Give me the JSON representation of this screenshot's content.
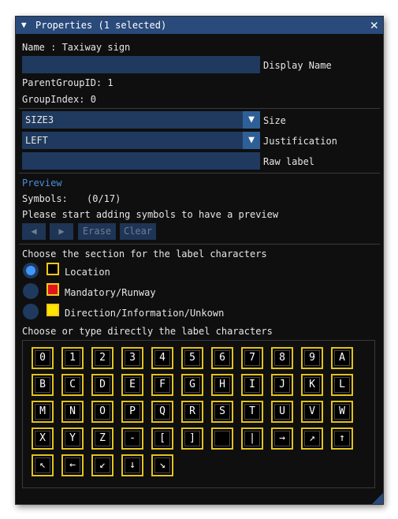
{
  "window": {
    "title": "Properties (1 selected)",
    "collapse_glyph": "▼",
    "close_glyph": "✕"
  },
  "info": {
    "name_line": "Name : Taxiway sign",
    "display_name_value": "",
    "display_name_label": "Display Name",
    "parent_group_line": "ParentGroupID: 1",
    "group_index_line": "GroupIndex: 0"
  },
  "controls": {
    "size_value": "SIZE3",
    "size_label": "Size",
    "justification_value": "LEFT",
    "justification_label": "Justification",
    "raw_label_value": "",
    "raw_label_label": "Raw label",
    "dropdown_glyph": "▼"
  },
  "preview": {
    "header": "Preview",
    "symbols_label": "Symbols:",
    "symbols_count": "(0/17)",
    "message": "Please start adding symbols to have a preview",
    "prev_glyph": "◀",
    "next_glyph": "▶",
    "erase_label": "Erase",
    "clear_label": "Clear"
  },
  "sections": {
    "prompt": "Choose the section for the label characters",
    "options": [
      {
        "label": "Location",
        "selected": true,
        "swatch": "#000000"
      },
      {
        "label": "Mandatory/Runway",
        "selected": false,
        "swatch": "#e0141c"
      },
      {
        "label": "Direction/Information/Unkown",
        "selected": false,
        "swatch": "#ffe600"
      }
    ]
  },
  "characters": {
    "prompt": "Choose or type directly the label characters",
    "keys": [
      "0",
      "1",
      "2",
      "3",
      "4",
      "5",
      "6",
      "7",
      "8",
      "9",
      "A",
      "B",
      "C",
      "D",
      "E",
      "F",
      "G",
      "H",
      "I",
      "J",
      "K",
      "L",
      "M",
      "N",
      "O",
      "P",
      "Q",
      "R",
      "S",
      "T",
      "U",
      "V",
      "W",
      "X",
      "Y",
      "Z",
      "-",
      "[",
      "]",
      "",
      "|",
      "→",
      "↗",
      "↑",
      "↖",
      "←",
      "↙",
      "↓",
      "↘"
    ]
  },
  "colors": {
    "title_bar": "#294a7a",
    "frame_bg": "#1f3a5e",
    "accent": "#4296fa",
    "key_border": "#e2c21d",
    "section_header": "#4a8fd8"
  }
}
